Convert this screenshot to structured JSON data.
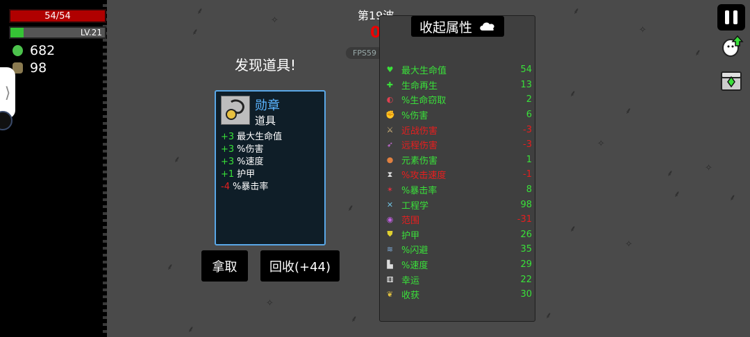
{
  "hud": {
    "hp_text": "54/54",
    "level_text": "LV.21",
    "xp_fraction": 0.14,
    "materials": "682",
    "bag_count": "98",
    "side_tab_arrow": "⟩"
  },
  "wave": {
    "label": "第19波",
    "timer": "0",
    "fps": "FPS59"
  },
  "item_popup": {
    "title": "发现道具!",
    "name": "勋章",
    "type": "道具",
    "icon": "medal-icon",
    "stats": [
      {
        "value": "+3",
        "label": "最大生命值",
        "sign": "pos"
      },
      {
        "value": "+3",
        "label": "%伤害",
        "sign": "pos"
      },
      {
        "value": "+3",
        "label": "%速度",
        "sign": "pos"
      },
      {
        "value": "+1",
        "label": "护甲",
        "sign": "pos"
      },
      {
        "value": "-4",
        "label": "%暴击率",
        "sign": "neg"
      }
    ],
    "take_label": "拿取",
    "recycle_label": "回收(+44)"
  },
  "stats_panel": {
    "collapse_label": "收起属性",
    "rows": [
      {
        "icon": "heart-icon",
        "glyph": "♥",
        "glyph_color": "#3ae03a",
        "label": "最大生命值",
        "value": "54",
        "color": "green"
      },
      {
        "icon": "regen-icon",
        "glyph": "✚",
        "glyph_color": "#3ae03a",
        "label": "生命再生",
        "value": "13",
        "color": "green"
      },
      {
        "icon": "lifesteal-icon",
        "glyph": "◐",
        "glyph_color": "#e04050",
        "label": "%生命窃取",
        "value": "2",
        "color": "green"
      },
      {
        "icon": "damage-icon",
        "glyph": "✊",
        "glyph_color": "#e06070",
        "label": "%伤害",
        "value": "6",
        "color": "green"
      },
      {
        "icon": "melee-icon",
        "glyph": "⚔",
        "glyph_color": "#e0c080",
        "label": "近战伤害",
        "value": "-3",
        "color": "red"
      },
      {
        "icon": "ranged-icon",
        "glyph": "➶",
        "glyph_color": "#d070e0",
        "label": "远程伤害",
        "value": "-3",
        "color": "red"
      },
      {
        "icon": "elemental-icon",
        "glyph": "●",
        "glyph_color": "#e08040",
        "label": "元素伤害",
        "value": "1",
        "color": "green"
      },
      {
        "icon": "hourglass-icon",
        "glyph": "⧗",
        "glyph_color": "#dddddd",
        "label": "%攻击速度",
        "value": "-1",
        "color": "red"
      },
      {
        "icon": "crit-icon",
        "glyph": "✶",
        "glyph_color": "#e03040",
        "label": "%暴击率",
        "value": "8",
        "color": "green"
      },
      {
        "icon": "engineering-icon",
        "glyph": "✕",
        "glyph_color": "#70c0e0",
        "label": "工程学",
        "value": "98",
        "color": "green"
      },
      {
        "icon": "range-icon",
        "glyph": "◉",
        "glyph_color": "#c060e0",
        "label": "范围",
        "value": "-31",
        "color": "red"
      },
      {
        "icon": "armor-icon",
        "glyph": "⛊",
        "glyph_color": "#e0d030",
        "label": "护甲",
        "value": "26",
        "color": "green"
      },
      {
        "icon": "dodge-icon",
        "glyph": "≋",
        "glyph_color": "#80b0e0",
        "label": "%闪避",
        "value": "35",
        "color": "green"
      },
      {
        "icon": "speed-icon",
        "glyph": "▙",
        "glyph_color": "#dddddd",
        "label": "%速度",
        "value": "29",
        "color": "green"
      },
      {
        "icon": "luck-icon",
        "glyph": "⚅",
        "glyph_color": "#ffffff",
        "label": "幸运",
        "value": "22",
        "color": "green"
      },
      {
        "icon": "harvest-icon",
        "glyph": "❦",
        "glyph_color": "#e0c040",
        "label": "收获",
        "value": "30",
        "color": "green"
      }
    ]
  }
}
